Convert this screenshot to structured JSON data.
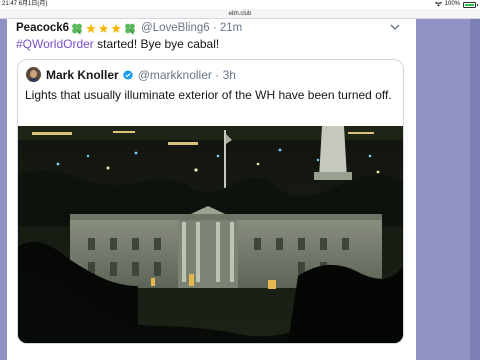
{
  "status_bar": {
    "time": "21:47",
    "date": "6月1日(月)",
    "battery": "100%",
    "battery_level": 1.0
  },
  "browser": {
    "url": "ebh.club"
  },
  "tweet": {
    "display_name": "Peacock6",
    "name_emoji": [
      "four-leaf-clover",
      "star",
      "star",
      "star",
      "four-leaf-clover"
    ],
    "handle": "@LoveBling6",
    "separator": "·",
    "time_ago": "21m",
    "hashtag": "#QWorldOrder",
    "text_rest": " started! Bye bye cabal!",
    "menu_icon": "chevron-down-icon"
  },
  "quoted_tweet": {
    "display_name": "Mark Knoller",
    "verified": true,
    "handle": "@markknoller",
    "separator": "·",
    "time_ago": "3h",
    "text": "Lights that usually illuminate exterior of the WH have been turned off.",
    "media": "night-photo-white-house"
  },
  "colors": {
    "page_background": "#8f92c2",
    "hashtag": "#7a4fc9",
    "verified_badge": "#1d9bf0",
    "star": "#f7b500",
    "clover": "#5cb85c"
  }
}
